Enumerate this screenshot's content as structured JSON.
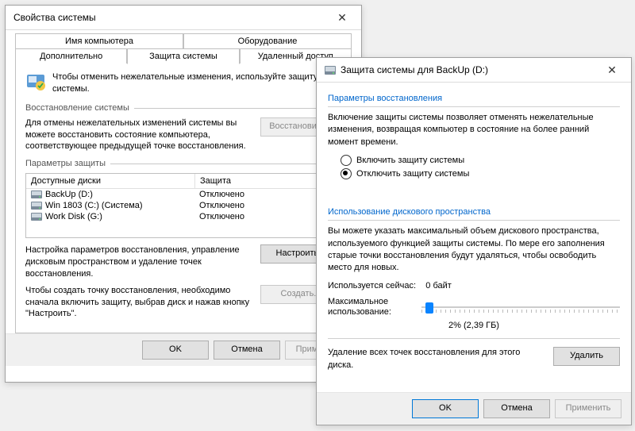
{
  "win1": {
    "title": "Свойства системы",
    "tabs_row1": [
      "Имя компьютера",
      "Оборудование"
    ],
    "tabs_row2": [
      "Дополнительно",
      "Защита системы",
      "Удаленный доступ"
    ],
    "active_tab": "Защита системы",
    "intro": "Чтобы отменить нежелательные изменения, используйте защиту системы.",
    "restore_section": "Восстановление системы",
    "restore_text": "Для отмены нежелательных изменений системы вы можете восстановить состояние компьютера, соответствующее предыдущей точке восстановления.",
    "restore_btn": "Восстановить...",
    "protect_section": "Параметры защиты",
    "col_drives": "Доступные диски",
    "col_prot": "Защита",
    "drives": [
      {
        "name": "BackUp (D:)",
        "prot": "Отключено"
      },
      {
        "name": "Win 1803 (C:) (Система)",
        "prot": "Отключено"
      },
      {
        "name": "Work Disk (G:)",
        "prot": "Отключено"
      }
    ],
    "configure_text": "Настройка параметров восстановления, управление дисковым пространством и удаление точек восстановления.",
    "configure_btn": "Настроить...",
    "create_text": "Чтобы создать точку восстановления, необходимо сначала включить защиту, выбрав диск и нажав кнопку \"Настроить\".",
    "create_btn": "Создать...",
    "ok": "OK",
    "cancel": "Отмена",
    "apply": "Применить"
  },
  "win2": {
    "title": "Защита системы для BackUp (D:)",
    "grp_restore": "Параметры восстановления",
    "restore_para": "Включение защиты системы позволяет отменять нежелательные изменения, возвращая компьютер в состояние на более ранний момент времени.",
    "radio_on": "Включить защиту системы",
    "radio_off": "Отключить защиту системы",
    "radio_selected": "off",
    "grp_disk": "Использование дискового пространства",
    "disk_para": "Вы можете указать максимальный объем дискового пространства, используемого функцией защиты системы. По мере его заполнения старые точки восстановления будут удаляться, чтобы освободить место для новых.",
    "used_label": "Используется сейчас:",
    "used_value": "0 байт",
    "max_label": "Максимальное использование:",
    "percent": "2% (2,39 ГБ)",
    "slider_pos_pct": 2,
    "delete_text": "Удаление всех точек восстановления для этого диска.",
    "delete_btn": "Удалить",
    "ok": "OK",
    "cancel": "Отмена",
    "apply": "Применить"
  }
}
